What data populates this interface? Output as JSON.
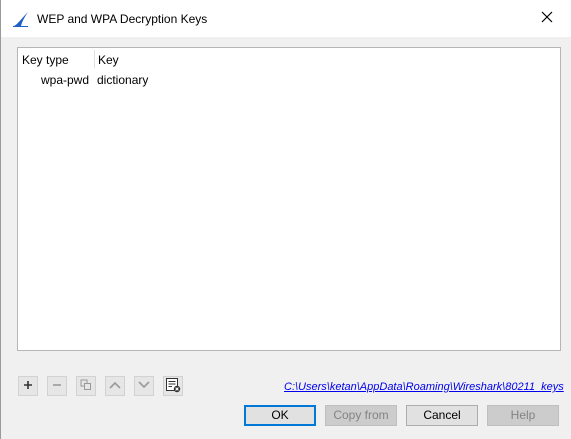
{
  "window": {
    "title": "WEP and WPA Decryption Keys"
  },
  "table": {
    "headers": [
      "Key type",
      "Key"
    ],
    "rows": [
      {
        "key_type": "wpa-pwd",
        "key": "dictionary"
      }
    ]
  },
  "toolbar": {
    "icons": [
      "add-icon",
      "remove-icon",
      "copy-icon",
      "move-up-icon",
      "move-down-icon",
      "clear-icon"
    ]
  },
  "file_path": "C:\\Users\\ketan\\AppData\\Roaming\\Wireshark\\80211_keys",
  "buttons": {
    "ok": "OK",
    "copy_from": "Copy from",
    "cancel": "Cancel",
    "help": "Help"
  },
  "colors": {
    "link": "#0000ee",
    "accent": "#0078d7",
    "shark_fin": "#1e60c8"
  }
}
